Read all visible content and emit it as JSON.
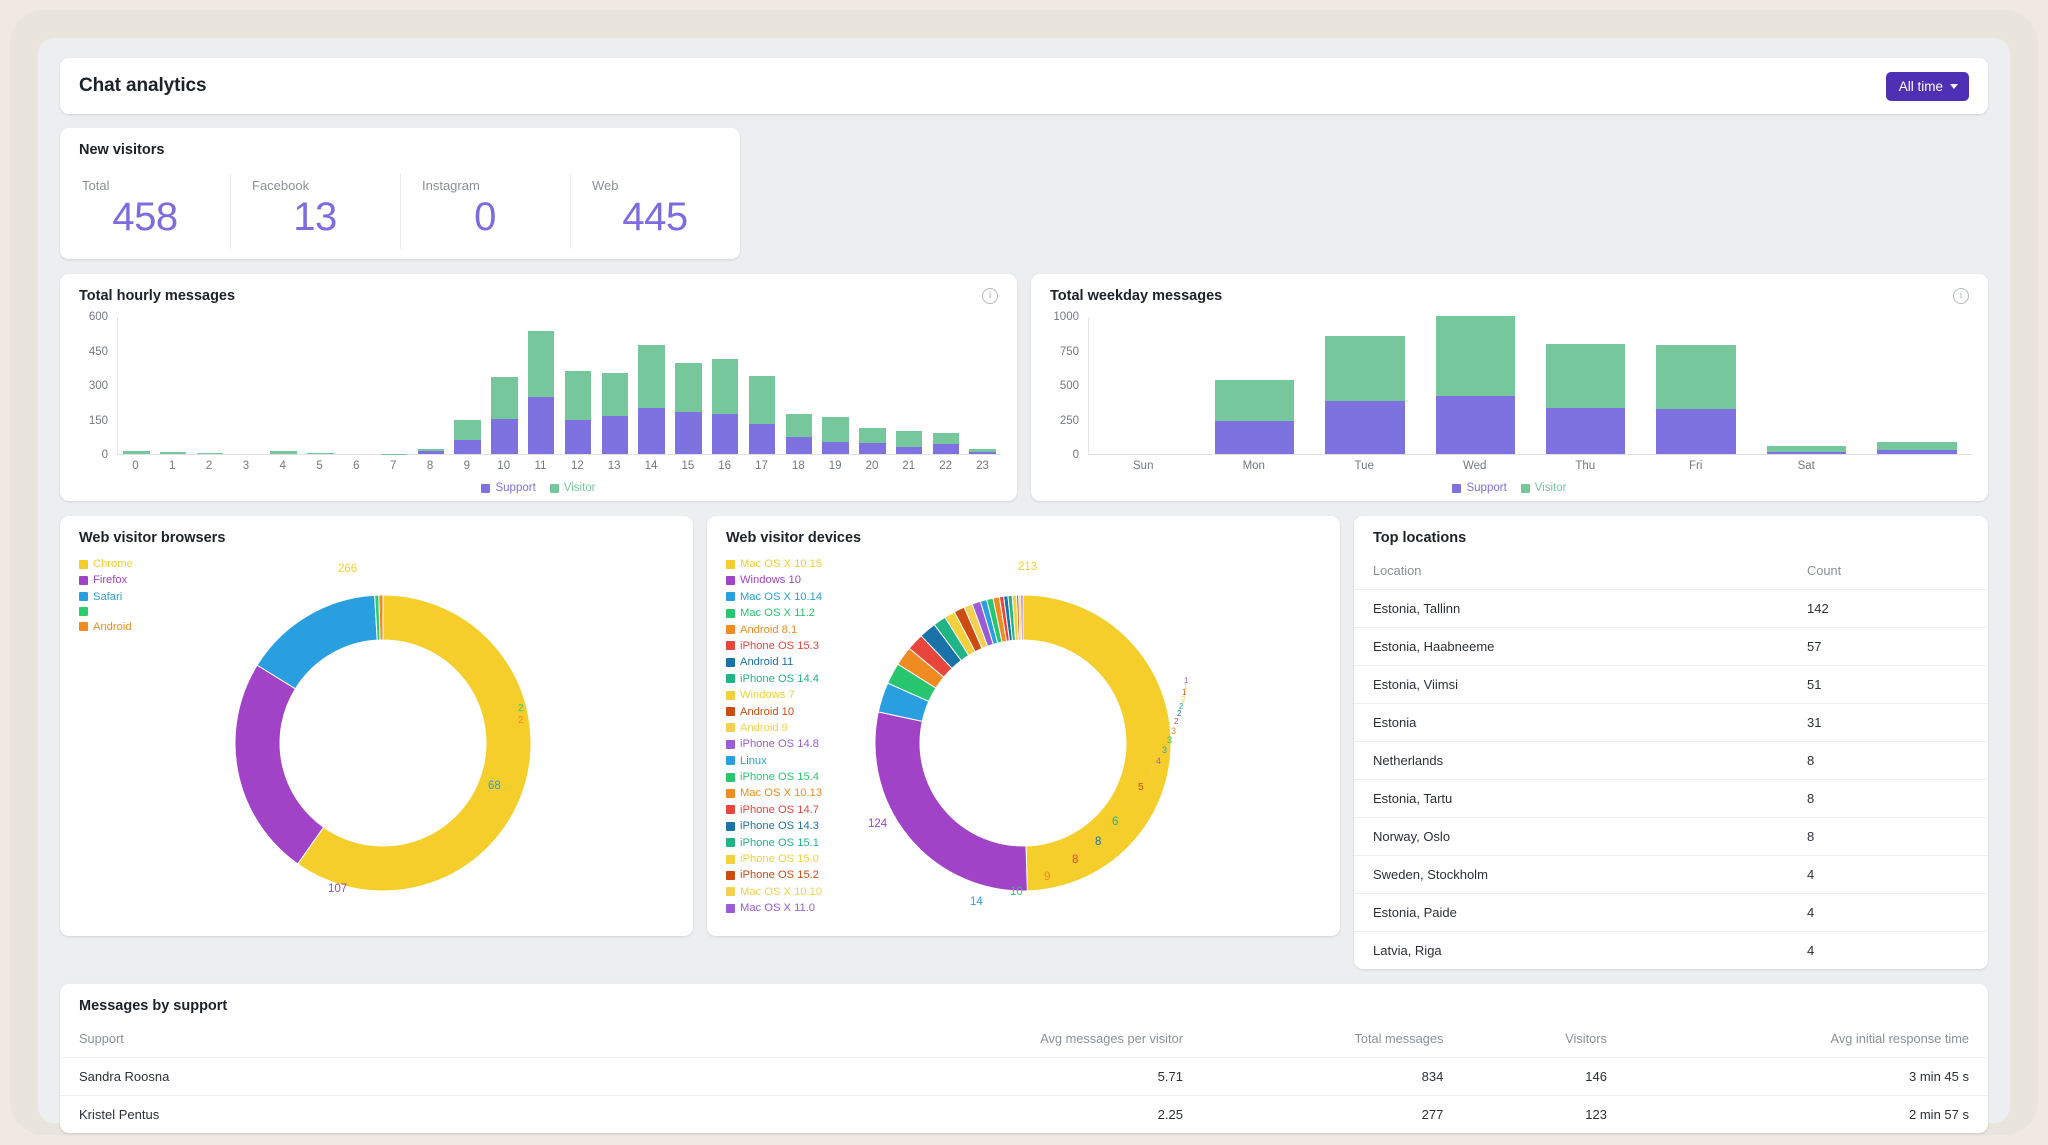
{
  "header": {
    "title": "Chat analytics",
    "range_button": "All time"
  },
  "new_visitors": {
    "title": "New visitors",
    "cells": [
      {
        "label": "Total",
        "value": "458"
      },
      {
        "label": "Facebook",
        "value": "13"
      },
      {
        "label": "Instagram",
        "value": "0"
      },
      {
        "label": "Web",
        "value": "445"
      }
    ]
  },
  "colors": {
    "support": "#7e71e0",
    "visitor": "#76c79b",
    "accent": "#4f2fb3",
    "value_purple": "#7b6ce0"
  },
  "hourly": {
    "title": "Total hourly messages",
    "info_icon": "info-icon",
    "legend": [
      {
        "label": "Support",
        "color": "#7e71e0"
      },
      {
        "label": "Visitor",
        "color": "#76c79b"
      }
    ]
  },
  "weekday": {
    "title": "Total weekday messages",
    "info_icon": "info-icon",
    "legend": [
      {
        "label": "Support",
        "color": "#7e71e0"
      },
      {
        "label": "Visitor",
        "color": "#76c79b"
      }
    ]
  },
  "browsers": {
    "title": "Web visitor browsers",
    "legend": [
      {
        "label": "Chrome",
        "color": "#f5ce2b"
      },
      {
        "label": "Firefox",
        "color": "#a143c6"
      },
      {
        "label": "Safari",
        "color": "#2a9fe0"
      },
      {
        "label": "",
        "color": "#2ecc71"
      },
      {
        "label": "Android",
        "color": "#ef8b20"
      }
    ]
  },
  "devices": {
    "title": "Web visitor devices",
    "legend": [
      {
        "label": "Mac OS X 10.15",
        "color": "#f5ce2b"
      },
      {
        "label": "Windows 10",
        "color": "#a143c6"
      },
      {
        "label": "Mac OS X 10.14",
        "color": "#2a9fe0"
      },
      {
        "label": "Mac OS X 11.2",
        "color": "#28c76f"
      },
      {
        "label": "Android 8.1",
        "color": "#ef8b20"
      },
      {
        "label": "iPhone OS 15.3",
        "color": "#e8453c"
      },
      {
        "label": "Android 11",
        "color": "#1a73a8"
      },
      {
        "label": "iPhone OS 14.4",
        "color": "#21b585"
      },
      {
        "label": "Windows 7",
        "color": "#f2d13c"
      },
      {
        "label": "Android 10",
        "color": "#cc4b10"
      },
      {
        "label": "Android 9",
        "color": "#f3d04f"
      },
      {
        "label": "iPhone OS 14.8",
        "color": "#9b5bd6"
      },
      {
        "label": "Linux",
        "color": "#2a9fe0"
      },
      {
        "label": "iPhone OS 15.4",
        "color": "#28c76f"
      },
      {
        "label": "Mac OS X 10.13",
        "color": "#ef8b20"
      },
      {
        "label": "iPhone OS 14.7",
        "color": "#e8453c"
      },
      {
        "label": "iPhone OS 14.3",
        "color": "#1a73a8"
      },
      {
        "label": "iPhone OS 15.1",
        "color": "#21b585"
      },
      {
        "label": "iPhone OS 15.0",
        "color": "#f2d13c"
      },
      {
        "label": "iPhone OS 15.2",
        "color": "#cc4b10"
      },
      {
        "label": "Mac OS X 10.10",
        "color": "#f3d04f"
      },
      {
        "label": "Mac OS X 11.0",
        "color": "#9b5bd6"
      }
    ]
  },
  "locations": {
    "title": "Top locations",
    "columns": [
      "Location",
      "Count"
    ],
    "rows": [
      {
        "location": "Estonia, Tallinn",
        "count": "142"
      },
      {
        "location": "Estonia, Haabneeme",
        "count": "57"
      },
      {
        "location": "Estonia, Viimsi",
        "count": "51"
      },
      {
        "location": "Estonia",
        "count": "31"
      },
      {
        "location": "Netherlands",
        "count": "8"
      },
      {
        "location": "Estonia, Tartu",
        "count": "8"
      },
      {
        "location": "Norway, Oslo",
        "count": "8"
      },
      {
        "location": "Sweden, Stockholm",
        "count": "4"
      },
      {
        "location": "Estonia, Paide",
        "count": "4"
      },
      {
        "location": "Latvia, Riga",
        "count": "4"
      }
    ]
  },
  "support_table": {
    "title": "Messages by support",
    "columns": [
      "Support",
      "Avg messages per visitor",
      "Total messages",
      "Visitors",
      "Avg initial response time"
    ],
    "rows": [
      {
        "support": "Sandra Roosna",
        "avg_messages": "5.71",
        "total_messages": "834",
        "visitors": "146",
        "avg_response": "3 min 45 s"
      },
      {
        "support": "Kristel Pentus",
        "avg_messages": "2.25",
        "total_messages": "277",
        "visitors": "123",
        "avg_response": "2 min 57 s"
      }
    ]
  },
  "chart_data": [
    {
      "type": "bar",
      "id": "hourly",
      "title": "Total hourly messages",
      "stacked": true,
      "xlabel": "",
      "ylabel": "",
      "ylim": [
        0,
        600
      ],
      "yticks": [
        0,
        150,
        300,
        450,
        600
      ],
      "grid": false,
      "legend_position": "bottom",
      "categories": [
        "0",
        "1",
        "2",
        "3",
        "4",
        "5",
        "6",
        "7",
        "8",
        "9",
        "10",
        "11",
        "12",
        "13",
        "14",
        "15",
        "16",
        "17",
        "18",
        "19",
        "20",
        "21",
        "22",
        "23"
      ],
      "series": [
        {
          "name": "Support",
          "color": "#7e71e0",
          "values": [
            0,
            0,
            0,
            0,
            0,
            0,
            0,
            0,
            12,
            62,
            153,
            249,
            146,
            165,
            201,
            181,
            175,
            130,
            74,
            52,
            46,
            30,
            42,
            8
          ]
        },
        {
          "name": "Visitor",
          "color": "#76c79b",
          "values": [
            14,
            10,
            4,
            0,
            11,
            5,
            0,
            2,
            12,
            85,
            181,
            286,
            213,
            186,
            272,
            213,
            240,
            211,
            102,
            110,
            65,
            68,
            51,
            13
          ]
        }
      ]
    },
    {
      "type": "bar",
      "id": "weekday",
      "title": "Total weekday messages",
      "stacked": true,
      "xlabel": "",
      "ylabel": "",
      "ylim": [
        0,
        1000
      ],
      "yticks": [
        0,
        250,
        500,
        750,
        1000
      ],
      "grid": false,
      "legend_position": "bottom",
      "categories": [
        "Sun",
        "Mon",
        "Tue",
        "Wed",
        "Thu",
        "Fri",
        "Sat",
        ""
      ],
      "series": [
        {
          "name": "Support",
          "color": "#7e71e0",
          "values": [
            0,
            238,
            387,
            422,
            335,
            325,
            15,
            30
          ]
        },
        {
          "name": "Visitor",
          "color": "#76c79b",
          "values": [
            0,
            295,
            470,
            578,
            463,
            465,
            45,
            60
          ]
        }
      ]
    },
    {
      "type": "pie",
      "id": "browsers",
      "title": "Web visitor browsers",
      "donut": true,
      "legend_position": "left",
      "labels": [
        "Chrome",
        "Firefox",
        "Safari",
        "",
        "Android"
      ],
      "values": [
        266,
        107,
        68,
        2,
        2
      ],
      "colors": [
        "#f5ce2b",
        "#a143c6",
        "#2a9fe0",
        "#2ecc71",
        "#ef8b20"
      ],
      "point_labels": [
        "266",
        "107",
        "68",
        "2",
        "2"
      ]
    },
    {
      "type": "pie",
      "id": "devices",
      "title": "Web visitor devices",
      "donut": true,
      "legend_position": "left",
      "labels": [
        "Mac OS X 10.15",
        "Windows 10",
        "Mac OS X 10.14",
        "Mac OS X 11.2",
        "Android 8.1",
        "iPhone OS 15.3",
        "Android 11",
        "iPhone OS 14.4",
        "Windows 7",
        "Android 10",
        "Android 9",
        "iPhone OS 14.8",
        "Linux",
        "iPhone OS 15.4",
        "Mac OS X 10.13",
        "iPhone OS 14.7",
        "iPhone OS 14.3",
        "iPhone OS 15.1",
        "iPhone OS 15.0",
        "iPhone OS 15.2",
        "Mac OS X 10.10",
        "Mac OS X 11.0"
      ],
      "values": [
        213,
        124,
        14,
        10,
        9,
        8,
        8,
        6,
        5,
        5,
        4,
        4,
        3,
        3,
        3,
        2,
        2,
        2,
        2,
        1,
        1,
        1
      ],
      "colors": [
        "#f5ce2b",
        "#a143c6",
        "#2a9fe0",
        "#28c76f",
        "#ef8b20",
        "#e8453c",
        "#1a73a8",
        "#21b585",
        "#f2d13c",
        "#cc4b10",
        "#f3d04f",
        "#9b5bd6",
        "#2a9fe0",
        "#28c76f",
        "#ef8b20",
        "#e8453c",
        "#1a73a8",
        "#21b585",
        "#f2d13c",
        "#cc4b10",
        "#f3d04f",
        "#9b5bd6"
      ],
      "point_labels": [
        "213",
        "124",
        "14",
        "10",
        "9",
        "8",
        "8",
        "6",
        "5",
        "5",
        "4",
        "4",
        "3",
        "3",
        "3",
        "2",
        "2",
        "2",
        "2",
        "1",
        "1",
        "1"
      ]
    }
  ]
}
